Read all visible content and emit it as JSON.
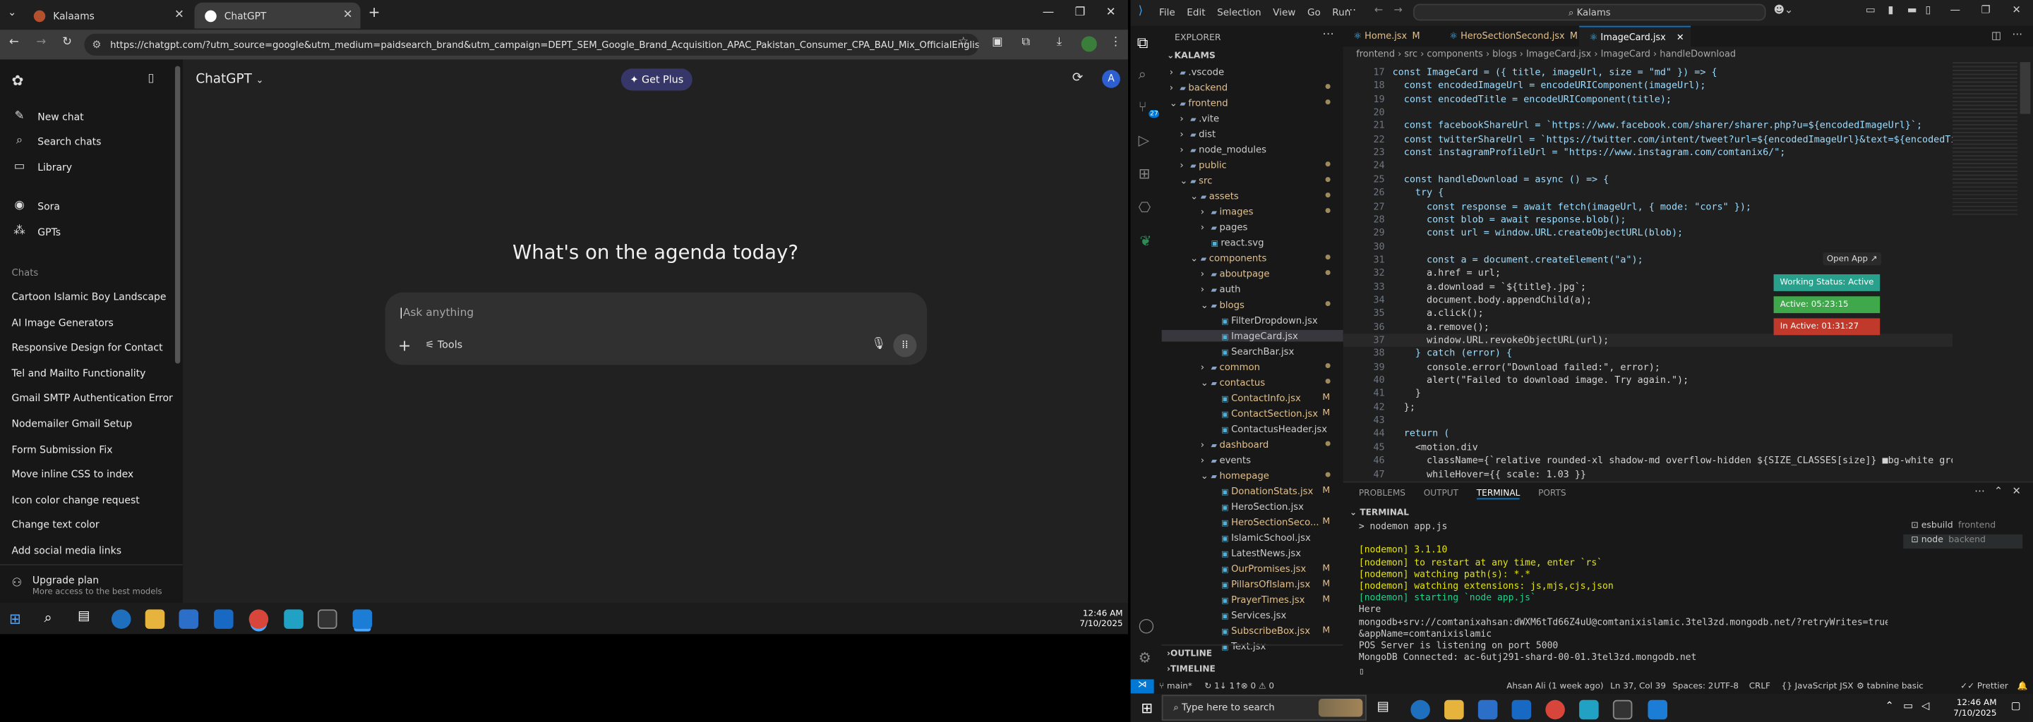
{
  "browser": {
    "tabs": [
      {
        "label": "Kalaams"
      },
      {
        "label": "ChatGPT"
      }
    ],
    "url": "https://chatgpt.com/?utm_source=google&utm_medium=paidsearch_brand&utm_campaign=DEPT_SEM_Google_Brand_Acquisition_APAC_Pakistan_Consumer_CPA_BAU_Mix_OfficialEnglish_H..."
  },
  "chatgpt": {
    "sidebar": {
      "new_chat": "New chat",
      "search_chats": "Search chats",
      "library": "Library",
      "sora": "Sora",
      "gpts": "GPTs",
      "chats_heading": "Chats",
      "chats": [
        "Cartoon Islamic Boy Landscape",
        "AI Image Generators",
        "Responsive Design for Contact",
        "Tel and Mailto Functionality",
        "Gmail SMTP Authentication Error",
        "Nodemailer Gmail Setup",
        "Form Submission Fix",
        "Move inline CSS to index",
        "Icon color change request",
        "Change text color",
        "Add social media links"
      ],
      "upgrade_title": "Upgrade plan",
      "upgrade_sub": "More access to the best models"
    },
    "model_label": "ChatGPT",
    "get_plus": "Get Plus",
    "avatar": "A",
    "headline": "What's on the agenda today?",
    "composer_placeholder": "Ask anything",
    "tools": "Tools"
  },
  "taskbar_left": {
    "time": "12:46 AM",
    "date": "7/10/2025"
  },
  "vscode": {
    "menu": [
      "File",
      "Edit",
      "Selection",
      "View",
      "Go",
      "Run"
    ],
    "search": "Kalams",
    "explorer_title": "EXPLORER",
    "root": "KALAMS",
    "tree": [
      {
        "name": ".vscode",
        "indent": 0,
        "kind": "folder-closed",
        "badge": ""
      },
      {
        "name": "backend",
        "indent": 0,
        "kind": "folder-closed",
        "badge": "dot"
      },
      {
        "name": "frontend",
        "indent": 0,
        "kind": "folder-open",
        "badge": "dot"
      },
      {
        "name": ".vite",
        "indent": 1,
        "kind": "folder-closed",
        "badge": ""
      },
      {
        "name": "dist",
        "indent": 1,
        "kind": "folder-closed",
        "badge": ""
      },
      {
        "name": "node_modules",
        "indent": 1,
        "kind": "folder-closed",
        "badge": ""
      },
      {
        "name": "public",
        "indent": 1,
        "kind": "folder-closed",
        "badge": "dot"
      },
      {
        "name": "src",
        "indent": 1,
        "kind": "folder-open",
        "badge": "dot"
      },
      {
        "name": "assets",
        "indent": 2,
        "kind": "folder-open",
        "badge": "dot"
      },
      {
        "name": "images",
        "indent": 3,
        "kind": "folder-closed",
        "badge": "dot"
      },
      {
        "name": "pages",
        "indent": 3,
        "kind": "folder-closed",
        "badge": ""
      },
      {
        "name": "react.svg",
        "indent": 3,
        "kind": "file",
        "badge": ""
      },
      {
        "name": "components",
        "indent": 2,
        "kind": "folder-open",
        "badge": "dot"
      },
      {
        "name": "aboutpage",
        "indent": 3,
        "kind": "folder-closed",
        "badge": "dot"
      },
      {
        "name": "auth",
        "indent": 3,
        "kind": "folder-closed",
        "badge": ""
      },
      {
        "name": "blogs",
        "indent": 3,
        "kind": "folder-open",
        "badge": "dot"
      },
      {
        "name": "FilterDropdown.jsx",
        "indent": 4,
        "kind": "file",
        "badge": ""
      },
      {
        "name": "ImageCard.jsx",
        "indent": 4,
        "kind": "file",
        "badge": "",
        "selected": true
      },
      {
        "name": "SearchBar.jsx",
        "indent": 4,
        "kind": "file",
        "badge": ""
      },
      {
        "name": "common",
        "indent": 3,
        "kind": "folder-closed",
        "badge": "dot"
      },
      {
        "name": "contactus",
        "indent": 3,
        "kind": "folder-open",
        "badge": "dot"
      },
      {
        "name": "ContactInfo.jsx",
        "indent": 4,
        "kind": "file",
        "badge": "M"
      },
      {
        "name": "ContactSection.jsx",
        "indent": 4,
        "kind": "file",
        "badge": "M"
      },
      {
        "name": "ContactusHeader.jsx",
        "indent": 4,
        "kind": "file",
        "badge": ""
      },
      {
        "name": "dashboard",
        "indent": 3,
        "kind": "folder-closed",
        "badge": "dot"
      },
      {
        "name": "events",
        "indent": 3,
        "kind": "folder-closed",
        "badge": ""
      },
      {
        "name": "homepage",
        "indent": 3,
        "kind": "folder-open",
        "badge": "dot"
      },
      {
        "name": "DonationStats.jsx",
        "indent": 4,
        "kind": "file",
        "badge": "M"
      },
      {
        "name": "HeroSection.jsx",
        "indent": 4,
        "kind": "file",
        "badge": ""
      },
      {
        "name": "HeroSectionSeco...",
        "indent": 4,
        "kind": "file",
        "badge": "M"
      },
      {
        "name": "IslamicSchool.jsx",
        "indent": 4,
        "kind": "file",
        "badge": ""
      },
      {
        "name": "LatestNews.jsx",
        "indent": 4,
        "kind": "file",
        "badge": ""
      },
      {
        "name": "OurPromises.jsx",
        "indent": 4,
        "kind": "file",
        "badge": "M"
      },
      {
        "name": "PillarsOfIslam.jsx",
        "indent": 4,
        "kind": "file",
        "badge": "M"
      },
      {
        "name": "PrayerTimes.jsx",
        "indent": 4,
        "kind": "file",
        "badge": "M"
      },
      {
        "name": "Services.jsx",
        "indent": 4,
        "kind": "file",
        "badge": ""
      },
      {
        "name": "SubscribeBox.jsx",
        "indent": 4,
        "kind": "file",
        "badge": "M"
      },
      {
        "name": "Text.jsx",
        "indent": 4,
        "kind": "file",
        "badge": ""
      }
    ],
    "outline": "OUTLINE",
    "timeline": "TIMELINE",
    "editor_tabs": [
      {
        "label": "Home.jsx",
        "badge": "M"
      },
      {
        "label": "HeroSectionSecond.jsx",
        "badge": "M"
      },
      {
        "label": "ImageCard.jsx",
        "badge": ""
      }
    ],
    "breadcrumb": [
      "frontend",
      "src",
      "components",
      "blogs",
      "ImageCard.jsx",
      "ImageCard",
      "handleDownload"
    ],
    "code_lines": [
      {
        "n": "17",
        "t": "const ImageCard = ({ title, imageUrl, size = \"md\" }) => {"
      },
      {
        "n": "18",
        "t": "  const encodedImageUrl = encodeURIComponent(imageUrl);"
      },
      {
        "n": "19",
        "t": "  const encodedTitle = encodeURIComponent(title);"
      },
      {
        "n": "20",
        "t": ""
      },
      {
        "n": "21",
        "t": "  const facebookShareUrl = `https://www.facebook.com/sharer/sharer.php?u=${encodedImageUrl}`;"
      },
      {
        "n": "22",
        "t": "  const twitterShareUrl = `https://twitter.com/intent/tweet?url=${encodedImageUrl}&text=${encodedTitle"
      },
      {
        "n": "23",
        "t": "  const instagramProfileUrl = \"https://www.instagram.com/comtanix6/\";"
      },
      {
        "n": "24",
        "t": ""
      },
      {
        "n": "25",
        "t": "  const handleDownload = async () => {"
      },
      {
        "n": "26",
        "t": "    try {"
      },
      {
        "n": "27",
        "t": "      const response = await fetch(imageUrl, { mode: \"cors\" });"
      },
      {
        "n": "28",
        "t": "      const blob = await response.blob();"
      },
      {
        "n": "29",
        "t": "      const url = window.URL.createObjectURL(blob);"
      },
      {
        "n": "30",
        "t": ""
      },
      {
        "n": "31",
        "t": "      const a = document.createElement(\"a\");"
      },
      {
        "n": "32",
        "t": "      a.href = url;"
      },
      {
        "n": "33",
        "t": "      a.download = `${title}.jpg`;"
      },
      {
        "n": "34",
        "t": "      document.body.appendChild(a);"
      },
      {
        "n": "35",
        "t": "      a.click();"
      },
      {
        "n": "36",
        "t": "      a.remove();"
      },
      {
        "n": "37",
        "t": "      window.URL.revokeObjectURL(url);"
      },
      {
        "n": "38",
        "t": "    } catch (error) {"
      },
      {
        "n": "39",
        "t": "      console.error(\"Download failed:\", error);"
      },
      {
        "n": "40",
        "t": "      alert(\"Failed to download image. Try again.\");"
      },
      {
        "n": "41",
        "t": "    }"
      },
      {
        "n": "42",
        "t": "  };"
      },
      {
        "n": "43",
        "t": ""
      },
      {
        "n": "44",
        "t": "  return ("
      },
      {
        "n": "45",
        "t": "    <motion.div"
      },
      {
        "n": "46",
        "t": "      className={`relative rounded-xl shadow-md overflow-hidden ${SIZE_CLASSES[size]} ■bg-white grou"
      },
      {
        "n": "47",
        "t": "      whileHover={{ scale: 1.03 }}"
      }
    ],
    "overlay": {
      "open_app": "Open App ↗",
      "status": "Working Status: Active",
      "active": "Active: 05:23:15",
      "inactive": "In Active: 01:31:27"
    },
    "panel_tabs": [
      "PROBLEMS",
      "OUTPUT",
      "TERMINAL",
      "PORTS"
    ],
    "terminal_title": "TERMINAL",
    "terminal_lines": [
      {
        "t": "> nodemon app.js",
        "c": "#cccccc"
      },
      {
        "t": "",
        "c": "#cccccc"
      },
      {
        "t": "[nodemon] 3.1.10",
        "c": "#e5e510"
      },
      {
        "t": "[nodemon] to restart at any time, enter `rs`",
        "c": "#e5e510"
      },
      {
        "t": "[nodemon] watching path(s): *.*",
        "c": "#e5e510"
      },
      {
        "t": "[nodemon] watching extensions: js,mjs,cjs,json",
        "c": "#e5e510"
      },
      {
        "t": "[nodemon] starting `node app.js`",
        "c": "#23d18b"
      },
      {
        "t": "Here",
        "c": "#cccccc"
      },
      {
        "t": "mongodb+srv://comtanixahsan:dWXM6tTd66Z4uU@comtanixislamic.3tel3zd.mongodb.net/?retryWrites=true&w=majority",
        "c": "#cccccc"
      },
      {
        "t": "&appName=comtanixislamic",
        "c": "#cccccc"
      },
      {
        "t": "POS Server is listening on port 5000",
        "c": "#cccccc"
      },
      {
        "t": "MongoDB Connected: ac-6utj291-shard-00-01.3tel3zd.mongodb.net",
        "c": "#cccccc"
      }
    ],
    "terminal_sessions": [
      {
        "label": "esbuild",
        "sub": "frontend"
      },
      {
        "label": "node",
        "sub": "backend"
      }
    ],
    "status": {
      "branch": "main*",
      "sync": "↻ 1↓ 1↑",
      "problems": "⊗ 0 ⚠ 0",
      "blame": "Ahsan Ali (1 week ago)",
      "position": "Ln 37, Col 39",
      "spaces": "Spaces: 2",
      "encoding": "UTF-8",
      "eol": "CRLF",
      "language": "JavaScript JSX",
      "tabnine": "tabnine basic",
      "prettier": "Prettier"
    }
  },
  "taskbar_right": {
    "search": "Type here to search",
    "time": "12:46 AM",
    "date": "7/10/2025"
  },
  "colors": {
    "active_green": "#3ea84a",
    "inactive_red": "#c0392b",
    "status_teal": "#28a08c",
    "git_modified": "#e2c08d",
    "accent_blue": "#0078d4"
  }
}
